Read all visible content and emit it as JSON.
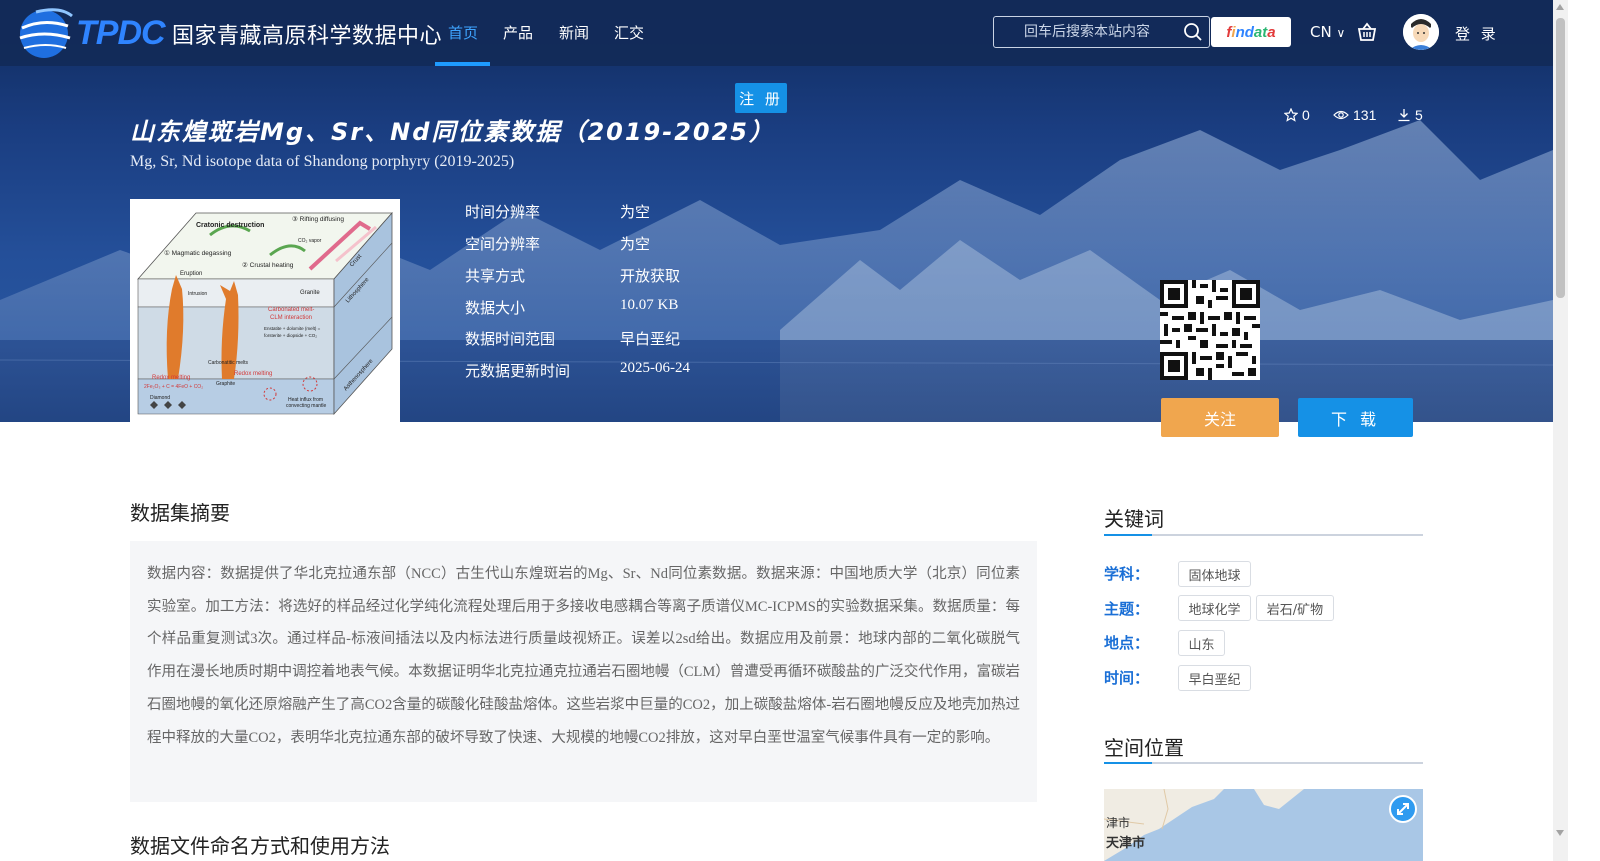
{
  "header": {
    "logo_text": "TPDC",
    "site_name": "国家青藏高原科学数据中心",
    "nav": [
      {
        "label": "首页",
        "active": true
      },
      {
        "label": "产品"
      },
      {
        "label": "新闻"
      },
      {
        "label": "汇交"
      }
    ],
    "search_placeholder": "回车后搜索本站内容",
    "findata_label": "findata",
    "lang": "CN",
    "login": "登 录",
    "register": "注 册"
  },
  "dataset": {
    "title": "山东煌斑岩Mg、Sr、Nd同位素数据（2019-2025）",
    "subtitle": "Mg, Sr, Nd isotope data of Shandong porphyry (2019-2025)",
    "stats": {
      "stars": "0",
      "views": "131",
      "downloads": "5"
    },
    "meta": [
      {
        "label": "时间分辨率",
        "value": "为空"
      },
      {
        "label": "空间分辨率",
        "value": "为空"
      },
      {
        "label": "共享方式",
        "value": "开放获取"
      },
      {
        "label": "数据大小",
        "value": "10.07 KB"
      },
      {
        "label": "数据时间范围",
        "value": "早白垩纪"
      },
      {
        "label": "元数据更新时间",
        "value": "2025-06-24"
      }
    ],
    "follow_label": "关注",
    "download_label": "下 载",
    "thumbnail_labels": {
      "cratonic": "Cratonic destruction",
      "rifting": "③ Rifting diffusing",
      "co2": "CO₂ vapor",
      "magmatic": "① Magmatic degassing",
      "crustal": "② Crustal heating",
      "eruption": "Eruption",
      "intrusion": "Intrusion",
      "granite": "Granite",
      "crust": "Crust",
      "lithosphere": "Lithosphere",
      "carbonated": "Carbonated melt-",
      "clm": "CLM interaction",
      "enstatite": "Enstatite + dolomite (melt) =",
      "forsterite": "forsterite + diopside + CO₂",
      "carbonatitic": "Carbonatitic melts",
      "redox1": "Redox melting",
      "redox2": "Redox melting",
      "graphite": "Graphite",
      "equation": "2Fe₂O₃ + C = 4FeO + CO₂",
      "diamond": "Diamond",
      "asthenosphere": "Asthenosphere",
      "heat": "Heat influx from",
      "convecting": "convecting mantle"
    }
  },
  "abstract": {
    "heading": "数据集摘要",
    "text": "数据内容：数据提供了华北克拉通东部（NCC）古生代山东煌斑岩的Mg、Sr、Nd同位素数据。数据来源：中国地质大学（北京）同位素实验室。加工方法：将选好的样品经过化学纯化流程处理后用于多接收电感耦合等离子质谱仪MC-ICPMS的实验数据采集。数据质量：每个样品重复测试3次。通过样品-标液间插法以及内标法进行质量歧视矫正。误差以2sd给出。数据应用及前景：地球内部的二氧化碳脱气作用在漫长地质时期中调控着地表气候。本数据证明华北克拉通克拉通岩石圈地幔（CLM）曾遭受再循环碳酸盐的广泛交代作用，富碳岩石圈地幔的氧化还原熔融产生了高CO2含量的碳酸化硅酸盐熔体。这些岩浆中巨量的CO2，加上碳酸盐熔体-岩石圈地幔反应及地壳加热过程中释放的大量CO2，表明华北克拉通东部的破坏导致了快速、大规模的地幔CO2排放，这对早白垩世温室气候事件具有一定的影响。"
  },
  "next_section_heading": "数据文件命名方式和使用方法",
  "sidebar": {
    "keywords_heading": "关键词",
    "groups": [
      {
        "label": "学科：",
        "tags": [
          "固体地球"
        ]
      },
      {
        "label": "主题：",
        "tags": [
          "地球化学",
          "岩石/矿物"
        ]
      },
      {
        "label": "地点：",
        "tags": [
          "山东"
        ]
      },
      {
        "label": "时间：",
        "tags": [
          "早白垩纪"
        ]
      }
    ],
    "location_heading": "空间位置",
    "map_labels": [
      "津市",
      "天津市"
    ]
  },
  "colors": {
    "accent_blue": "#1591e6",
    "follow_orange": "#f0a64e",
    "keyword_label": "#1a6fd6"
  }
}
